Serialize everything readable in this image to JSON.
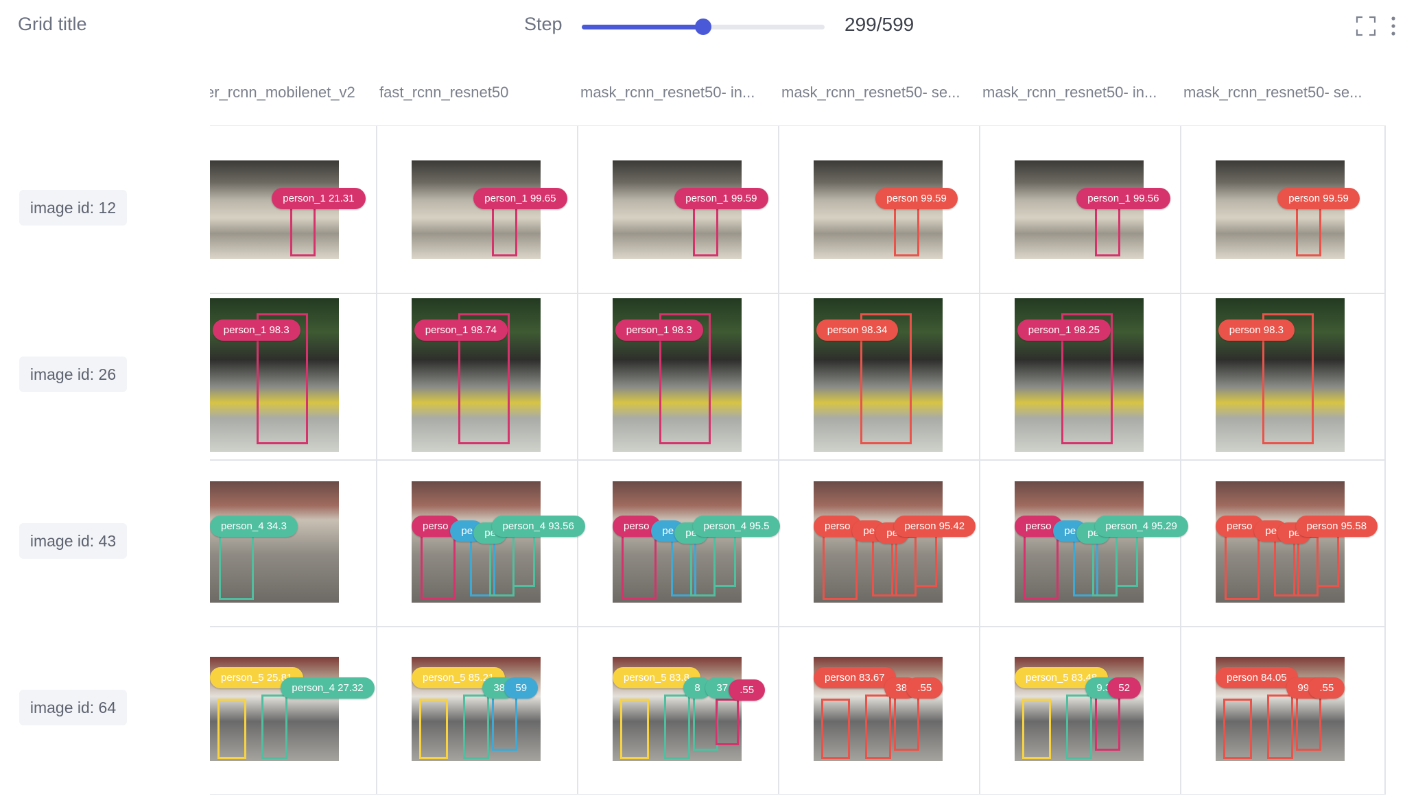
{
  "header": {
    "title": "Grid title",
    "step_label": "Step",
    "step_value": "299/599",
    "step_fraction": 0.5
  },
  "columns": [
    "er_rcnn_mobilenet_v2",
    "fast_rcnn_resnet50",
    "mask_rcnn_resnet50- in...",
    "mask_rcnn_resnet50- se...",
    "mask_rcnn_resnet50- in...",
    "mask_rcnn_resnet50- se..."
  ],
  "colors": {
    "pink": "#d6336c",
    "red": "#ea5349",
    "teal": "#50bfa0",
    "blue": "#3fa9d5",
    "yellow": "#f9d33f",
    "slider": "#4959d8"
  },
  "rows": [
    {
      "label": "image id: 12",
      "scene": "building",
      "cells": [
        {
          "tags": [
            {
              "text": "person_1 21.31",
              "color": "pink"
            }
          ]
        },
        {
          "tags": [
            {
              "text": "person_1 99.65",
              "color": "pink"
            }
          ]
        },
        {
          "tags": [
            {
              "text": "person_1 99.59",
              "color": "pink"
            }
          ]
        },
        {
          "tags": [
            {
              "text": "person 99.59",
              "color": "red"
            }
          ]
        },
        {
          "tags": [
            {
              "text": "person_1 99.56",
              "color": "pink"
            }
          ]
        },
        {
          "tags": [
            {
              "text": "person 99.59",
              "color": "red"
            }
          ]
        }
      ]
    },
    {
      "label": "image id: 26",
      "scene": "street",
      "cells": [
        {
          "tags": [
            {
              "text": "person_1 98.3",
              "color": "pink"
            }
          ]
        },
        {
          "tags": [
            {
              "text": "person_1 98.74",
              "color": "pink"
            }
          ]
        },
        {
          "tags": [
            {
              "text": "person_1 98.3",
              "color": "pink"
            }
          ]
        },
        {
          "tags": [
            {
              "text": "person 98.34",
              "color": "red"
            }
          ]
        },
        {
          "tags": [
            {
              "text": "person_1 98.25",
              "color": "pink"
            }
          ]
        },
        {
          "tags": [
            {
              "text": "person 98.3",
              "color": "red"
            }
          ]
        }
      ]
    },
    {
      "label": "image id: 43",
      "scene": "crowd",
      "cells": [
        {
          "tags": [
            {
              "text": "person_4 34.3",
              "color": "teal"
            }
          ]
        },
        {
          "tags": [
            {
              "text": "perso",
              "color": "pink"
            },
            {
              "text": "pe",
              "color": "blue"
            },
            {
              "text": "pe",
              "color": "teal"
            },
            {
              "text": "person_4 93.56",
              "color": "teal"
            }
          ]
        },
        {
          "tags": [
            {
              "text": "perso",
              "color": "pink"
            },
            {
              "text": "pe",
              "color": "blue"
            },
            {
              "text": "pe",
              "color": "teal"
            },
            {
              "text": "person_4 95.5",
              "color": "teal"
            }
          ]
        },
        {
          "tags": [
            {
              "text": "perso",
              "color": "red"
            },
            {
              "text": "pe",
              "color": "red"
            },
            {
              "text": "pe",
              "color": "red"
            },
            {
              "text": "person 95.42",
              "color": "red"
            }
          ]
        },
        {
          "tags": [
            {
              "text": "perso",
              "color": "pink"
            },
            {
              "text": "pe",
              "color": "blue"
            },
            {
              "text": "pe",
              "color": "teal"
            },
            {
              "text": "person_4 95.29",
              "color": "teal"
            }
          ]
        },
        {
          "tags": [
            {
              "text": "perso",
              "color": "red"
            },
            {
              "text": "pe",
              "color": "red"
            },
            {
              "text": "pe",
              "color": "red"
            },
            {
              "text": "person 95.58",
              "color": "red"
            }
          ]
        }
      ]
    },
    {
      "label": "image id: 64",
      "scene": "market",
      "cells": [
        {
          "tags": [
            {
              "text": "person_5 25.81",
              "color": "yellow"
            },
            {
              "text": "person_4 27.32",
              "color": "teal"
            }
          ]
        },
        {
          "tags": [
            {
              "text": "person_5 85.21",
              "color": "yellow"
            },
            {
              "text": "38",
              "color": "teal"
            },
            {
              "text": "59",
              "color": "blue"
            }
          ]
        },
        {
          "tags": [
            {
              "text": "person_5 83.8",
              "color": "yellow"
            },
            {
              "text": "8",
              "color": "teal"
            },
            {
              "text": "37",
              "color": "teal"
            },
            {
              "text": ".55",
              "color": "pink"
            }
          ]
        },
        {
          "tags": [
            {
              "text": "person 83.67",
              "color": "red"
            },
            {
              "text": "38",
              "color": "red"
            },
            {
              "text": ".55",
              "color": "red"
            }
          ]
        },
        {
          "tags": [
            {
              "text": "person_5 83.48",
              "color": "yellow"
            },
            {
              "text": "9.35",
              "color": "teal"
            },
            {
              "text": "52",
              "color": "pink"
            }
          ]
        },
        {
          "tags": [
            {
              "text": "person 84.05",
              "color": "red"
            },
            {
              "text": "99.37",
              "color": "red"
            },
            {
              "text": ".55",
              "color": "red"
            }
          ]
        }
      ]
    }
  ]
}
